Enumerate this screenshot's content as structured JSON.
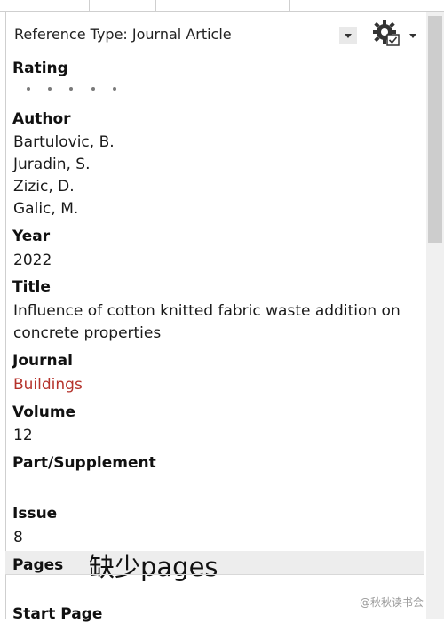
{
  "reference_type": {
    "label": "Reference Type:",
    "value": "Journal Article"
  },
  "icons": {
    "dropdown": "chevron-down-icon",
    "settings": "gear-with-check-icon"
  },
  "fields": {
    "rating": {
      "label": "Rating",
      "count": 5
    },
    "author": {
      "label": "Author",
      "values": [
        "Bartulovic, B.",
        "Juradin, S.",
        "Zizic, D.",
        "Galic, M."
      ]
    },
    "year": {
      "label": "Year",
      "value": "2022"
    },
    "title": {
      "label": "Title",
      "line1": "Influence of cotton knitted fabric waste addition on",
      "line2": "concrete properties"
    },
    "journal": {
      "label": "Journal",
      "value": "Buildings"
    },
    "volume": {
      "label": "Volume",
      "value": "12"
    },
    "part_supplement": {
      "label": "Part/Supplement",
      "value": ""
    },
    "issue": {
      "label": "Issue",
      "value": "8"
    },
    "pages": {
      "label": "Pages",
      "value": ""
    },
    "start_page": {
      "label": "Start Page"
    }
  },
  "annotation": "缺少pages",
  "watermark": "@秋秋读书会",
  "colors": {
    "journal_link": "#b5322b",
    "highlight": "#ededed"
  }
}
